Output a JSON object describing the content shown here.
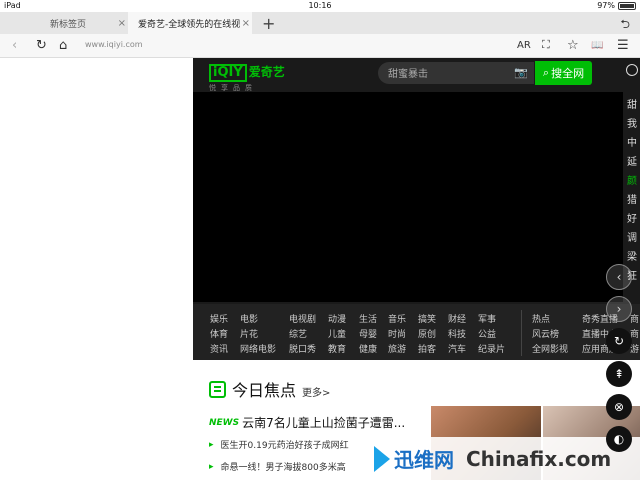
{
  "status_bar": {
    "device": "iPad",
    "time": "10:16",
    "battery": "97%"
  },
  "tabs": [
    {
      "title": "新标签页",
      "close": "×"
    },
    {
      "title": "爱奇艺-全球领先的在线视",
      "close": "×"
    }
  ],
  "tab_controls": {
    "new_tab": "+",
    "menu": "⮌"
  },
  "toolbar": {
    "back": "‹",
    "reload": "↻",
    "home": "⌂",
    "url": "www.iqiyi.com",
    "ar": "AR",
    "scan": "⛶",
    "favorite": "☆",
    "reader": "📖",
    "menu": "☰"
  },
  "site": {
    "logo_mark": "iQIY",
    "logo_name": "爱奇艺",
    "slogan": "悦享品质",
    "search_placeholder": "甜蜜暴击",
    "camera": "📷",
    "search_button": "搜全网",
    "search_icon": "⌕",
    "side_list": [
      {
        "text": "甜",
        "active": false
      },
      {
        "text": "我",
        "active": false
      },
      {
        "text": "中",
        "active": false
      },
      {
        "text": "延",
        "active": false
      },
      {
        "text": "颜",
        "active": true
      },
      {
        "text": "猎",
        "active": false
      },
      {
        "text": "好",
        "active": false
      },
      {
        "text": "调",
        "active": false
      },
      {
        "text": "梁",
        "active": false
      },
      {
        "text": "狂",
        "active": false
      }
    ],
    "nav_cols": [
      [
        "娱乐",
        "体育",
        "资讯"
      ],
      [
        "电影",
        "片花",
        "网络电影"
      ],
      [
        "电视剧",
        "综艺",
        "脱口秀"
      ],
      [
        "动漫",
        "儿童",
        "教育"
      ],
      [
        "生活",
        "母婴",
        "健康"
      ],
      [
        "音乐",
        "时尚",
        "旅游"
      ],
      [
        "搞笑",
        "原创",
        "拍客"
      ],
      [
        "财经",
        "科技",
        "汽车"
      ],
      [
        "军事",
        "公益",
        "纪录片"
      ],
      [
        "热点",
        "风云榜",
        "全网影视"
      ],
      [
        "奇秀直播",
        "直播中心",
        "应用商店"
      ],
      [
        "商",
        "商",
        "游"
      ]
    ],
    "focus_title": "今日焦点",
    "focus_more": "更多>",
    "news_tag": "NEWS",
    "news_headline": "云南7名儿童上山捡菌子遭雷...",
    "bullets": [
      "医生开0.19元药治好孩子成网红",
      "命悬一线！男子海拔800多米高"
    ]
  },
  "floating_buttons": {
    "prev": "‹",
    "next": "›",
    "refresh": "↻",
    "top": "⇞",
    "more": "⊗",
    "extra": "◐"
  },
  "watermark": {
    "cn": "迅维网",
    "en": "Chinafix.com"
  }
}
